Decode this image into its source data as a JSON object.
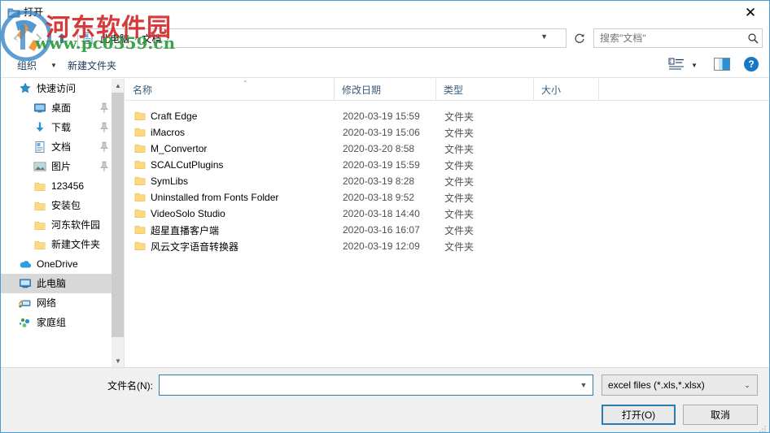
{
  "window": {
    "title": "打开",
    "close_label": "✕",
    "title_icon": "folder-open-icon"
  },
  "address": {
    "back_icon": "back-arrow-icon",
    "forward_icon": "forward-arrow-icon",
    "up_icon": "up-arrow-icon",
    "crumb_icon": "documents-icon",
    "crumbs": [
      "此电脑",
      "文档"
    ],
    "separator": "›",
    "dropdown_icon": "chevron-down-icon",
    "refresh_icon": "refresh-icon"
  },
  "search": {
    "placeholder": "搜索\"文档\"",
    "value": "",
    "icon": "search-icon"
  },
  "toolbar": {
    "organize_label": "组织",
    "organize_arrow": "▼",
    "new_folder_label": "新建文件夹",
    "view_icon": "view-list-icon",
    "view_arrow": "▼",
    "preview_pane_icon": "preview-pane-icon",
    "help_icon": "?",
    "help_label": "?"
  },
  "sidebar": {
    "scroll_up_icon": "chevron-up-icon",
    "scroll_down_icon": "chevron-down-icon",
    "items": [
      {
        "label": "快速访问",
        "icon": "star-pin-icon",
        "level": 0,
        "pinned": false,
        "selected": false
      },
      {
        "label": "桌面",
        "icon": "desktop-icon",
        "level": 1,
        "pinned": true,
        "selected": false
      },
      {
        "label": "下载",
        "icon": "download-icon",
        "level": 1,
        "pinned": true,
        "selected": false
      },
      {
        "label": "文档",
        "icon": "documents-icon",
        "level": 1,
        "pinned": true,
        "selected": false
      },
      {
        "label": "图片",
        "icon": "pictures-icon",
        "level": 1,
        "pinned": true,
        "selected": false
      },
      {
        "label": "123456",
        "icon": "folder-icon",
        "level": 1,
        "pinned": false,
        "selected": false
      },
      {
        "label": "安装包",
        "icon": "folder-icon",
        "level": 1,
        "pinned": false,
        "selected": false
      },
      {
        "label": "河东软件园",
        "icon": "folder-icon",
        "level": 1,
        "pinned": false,
        "selected": false
      },
      {
        "label": "新建文件夹",
        "icon": "folder-icon",
        "level": 1,
        "pinned": false,
        "selected": false
      },
      {
        "label": "OneDrive",
        "icon": "onedrive-cloud-icon",
        "level": 0,
        "pinned": false,
        "selected": false
      },
      {
        "label": "此电脑",
        "icon": "this-pc-icon",
        "level": 0,
        "pinned": false,
        "selected": true
      },
      {
        "label": "网络",
        "icon": "network-icon",
        "level": 0,
        "pinned": false,
        "selected": false
      },
      {
        "label": "家庭组",
        "icon": "homegroup-icon",
        "level": 0,
        "pinned": false,
        "selected": false
      }
    ]
  },
  "file_list": {
    "columns": [
      {
        "label": "名称",
        "key": "name",
        "sorted": true,
        "sort_caret": "⌃"
      },
      {
        "label": "修改日期",
        "key": "date",
        "sorted": false
      },
      {
        "label": "类型",
        "key": "type",
        "sorted": false
      },
      {
        "label": "大小",
        "key": "size",
        "sorted": false
      }
    ],
    "rows": [
      {
        "icon": "folder-icon",
        "name": "Craft Edge",
        "date": "2020-03-19 15:59",
        "type": "文件夹",
        "size": ""
      },
      {
        "icon": "folder-icon",
        "name": "iMacros",
        "date": "2020-03-19 15:06",
        "type": "文件夹",
        "size": ""
      },
      {
        "icon": "folder-icon",
        "name": "M_Convertor",
        "date": "2020-03-20 8:58",
        "type": "文件夹",
        "size": ""
      },
      {
        "icon": "folder-icon",
        "name": "SCALCutPlugins",
        "date": "2020-03-19 15:59",
        "type": "文件夹",
        "size": ""
      },
      {
        "icon": "folder-icon",
        "name": "SymLibs",
        "date": "2020-03-19 8:28",
        "type": "文件夹",
        "size": ""
      },
      {
        "icon": "folder-icon",
        "name": "Uninstalled from Fonts Folder",
        "date": "2020-03-18 9:52",
        "type": "文件夹",
        "size": ""
      },
      {
        "icon": "folder-icon",
        "name": "VideoSolo Studio",
        "date": "2020-03-18 14:40",
        "type": "文件夹",
        "size": ""
      },
      {
        "icon": "folder-icon",
        "name": "超星直播客户端",
        "date": "2020-03-16 16:07",
        "type": "文件夹",
        "size": ""
      },
      {
        "icon": "folder-icon",
        "name": "风云文字语音转换器",
        "date": "2020-03-19 12:09",
        "type": "文件夹",
        "size": ""
      }
    ]
  },
  "footer": {
    "filename_label": "文件名(N):",
    "filename_value": "",
    "filename_placeholder": "",
    "filename_chevron": "chevron-down-icon",
    "filter_value": "excel files (*.xls,*.xlsx)",
    "filter_chevron": "chevron-down-icon",
    "open_label": "打开(O)",
    "cancel_label": "取消",
    "resize_grip_icon": "resize-grip-icon"
  },
  "watermark": {
    "brand": "河东软件园",
    "url": "www.pc0359.cn",
    "logo_icon": "hedong-logo-icon"
  },
  "colors": {
    "accent": "#2b7cb0",
    "dialog_border": "#4b9cd3",
    "folder": "#ffd980",
    "selection": "#d8d8d8",
    "watermark_brand": "#d32b2b",
    "watermark_url": "#2e9c3c"
  }
}
